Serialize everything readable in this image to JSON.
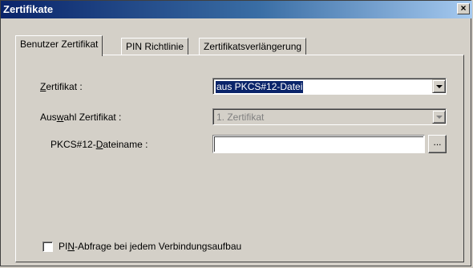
{
  "window": {
    "title": "Zertifikate",
    "close_glyph": "×"
  },
  "tabs": [
    {
      "label": "Benutzer Zertifikat",
      "active": true
    },
    {
      "label": "PIN Richtlinie",
      "active": false
    },
    {
      "label": "Zertifikatsverlängerung",
      "active": false
    }
  ],
  "form": {
    "zertifikat": {
      "label_prefix": "",
      "label_mnemonic": "Z",
      "label_suffix": "ertifikat :",
      "value": "aus PKCS#12-Datei"
    },
    "auswahl": {
      "label_prefix": "Aus",
      "label_mnemonic": "w",
      "label_suffix": "ahl Zertifikat :",
      "value": "1. Zertifikat"
    },
    "dateiname": {
      "label_prefix": "PKCS#12-",
      "label_mnemonic": "D",
      "label_suffix": "ateiname :",
      "value": "",
      "browse_label": "..."
    },
    "pin_abfrage": {
      "label_prefix": "PI",
      "label_mnemonic": "N",
      "label_suffix": "-Abfrage bei jedem Verbindungsaufbau",
      "checked": false
    }
  },
  "icons": {
    "dropdown": "chevron-down-icon",
    "close": "close-icon"
  }
}
